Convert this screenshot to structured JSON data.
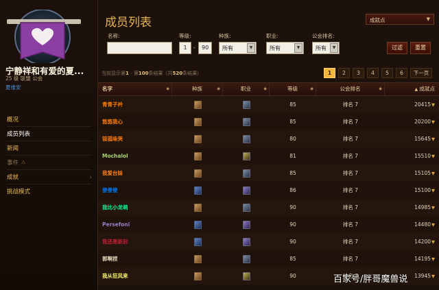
{
  "guild": {
    "name": "宁静祥和有爱的夏...",
    "subline": "25 级 联盟 公会",
    "realm": "夏维安"
  },
  "nav": [
    {
      "label": "概况",
      "state": "normal"
    },
    {
      "label": "成员列表",
      "state": "active"
    },
    {
      "label": "新闻",
      "state": "normal"
    },
    {
      "label": "事件",
      "state": "sub"
    },
    {
      "label": "成就",
      "state": "normal"
    },
    {
      "label": "挑战模式",
      "state": "normal"
    }
  ],
  "page_title": "成员列表",
  "view_select": "成就点",
  "filters": {
    "name_label": "名称:",
    "name_value": "",
    "level_label": "等级:",
    "level_min": "1",
    "level_dash": "-",
    "level_max": "90",
    "race_label": "种族:",
    "race_value": "所有",
    "class_label": "职业:",
    "class_value": "所有",
    "rank_label": "公会排名:",
    "rank_value": "所有",
    "filter_button": "过滤",
    "reset_button": "重置"
  },
  "results": {
    "prefix": "当前显示第",
    "from": "1",
    "mid": " - 第",
    "to": "100",
    "suffix": "条结果（共",
    "total": "520",
    "suffix2": "条结果）"
  },
  "pagination": {
    "pages": [
      "1",
      "2",
      "3",
      "4",
      "5",
      "6"
    ],
    "current": "1",
    "next": "下一页"
  },
  "columns": {
    "name": "名字",
    "race": "种族",
    "class": "职业",
    "level": "等级",
    "rank": "公会排名",
    "achievements": "成就点"
  },
  "members": [
    {
      "name": "青青子衿",
      "color": "#ff7d0a",
      "race_icon": "race-icon",
      "class_icon": "warrior",
      "level": "85",
      "rank": "排名 7",
      "points": "20415"
    },
    {
      "name": "悠悠我心",
      "color": "#ff7d0a",
      "race_icon": "race-icon",
      "class_icon": "warrior",
      "level": "85",
      "rank": "排名 7",
      "points": "20200"
    },
    {
      "name": "铵孤咏哭",
      "color": "#ff7d0a",
      "race_icon": "race-icon",
      "class_icon": "warrior",
      "level": "80",
      "rank": "排名 7",
      "points": "15645"
    },
    {
      "name": "Mochalol",
      "color": "#abd473",
      "race_icon": "race-icon",
      "class_icon": "rogue",
      "level": "81",
      "rank": "排名 7",
      "points": "15510"
    },
    {
      "name": "我爱台妹",
      "color": "#ff7d0a",
      "race_icon": "race-icon",
      "class_icon": "warrior",
      "level": "85",
      "rank": "排名 7",
      "points": "15105"
    },
    {
      "name": "傻傻傻",
      "color": "#0070de",
      "race_icon": "race-icon",
      "class_icon": "caster",
      "level": "86",
      "rank": "排名 7",
      "points": "15100"
    },
    {
      "name": "我比小龙萌",
      "color": "#00ff96",
      "race_icon": "race-icon",
      "class_icon": "warrior",
      "level": "90",
      "rank": "排名 7",
      "points": "14985"
    },
    {
      "name": "Persefoni",
      "color": "#9482c9",
      "race_icon": "race-icon",
      "class_icon": "caster",
      "level": "90",
      "rank": "排名 7",
      "points": "14480"
    },
    {
      "name": "我还是新封",
      "color": "#c41e3a",
      "race_icon": "race-icon",
      "class_icon": "caster",
      "level": "90",
      "rank": "排名 7",
      "points": "14200"
    },
    {
      "name": "郭啊捏",
      "color": "#e8d9b8",
      "race_icon": "race-icon",
      "class_icon": "warrior",
      "level": "85",
      "rank": "排名 7",
      "points": "14195"
    },
    {
      "name": "我从狂风来",
      "color": "#fff569",
      "race_icon": "race-icon",
      "class_icon": "rogue",
      "level": "90",
      "rank": "排名 7",
      "points": "13945"
    }
  ],
  "watermark": "百家号/胖哥魔兽说"
}
